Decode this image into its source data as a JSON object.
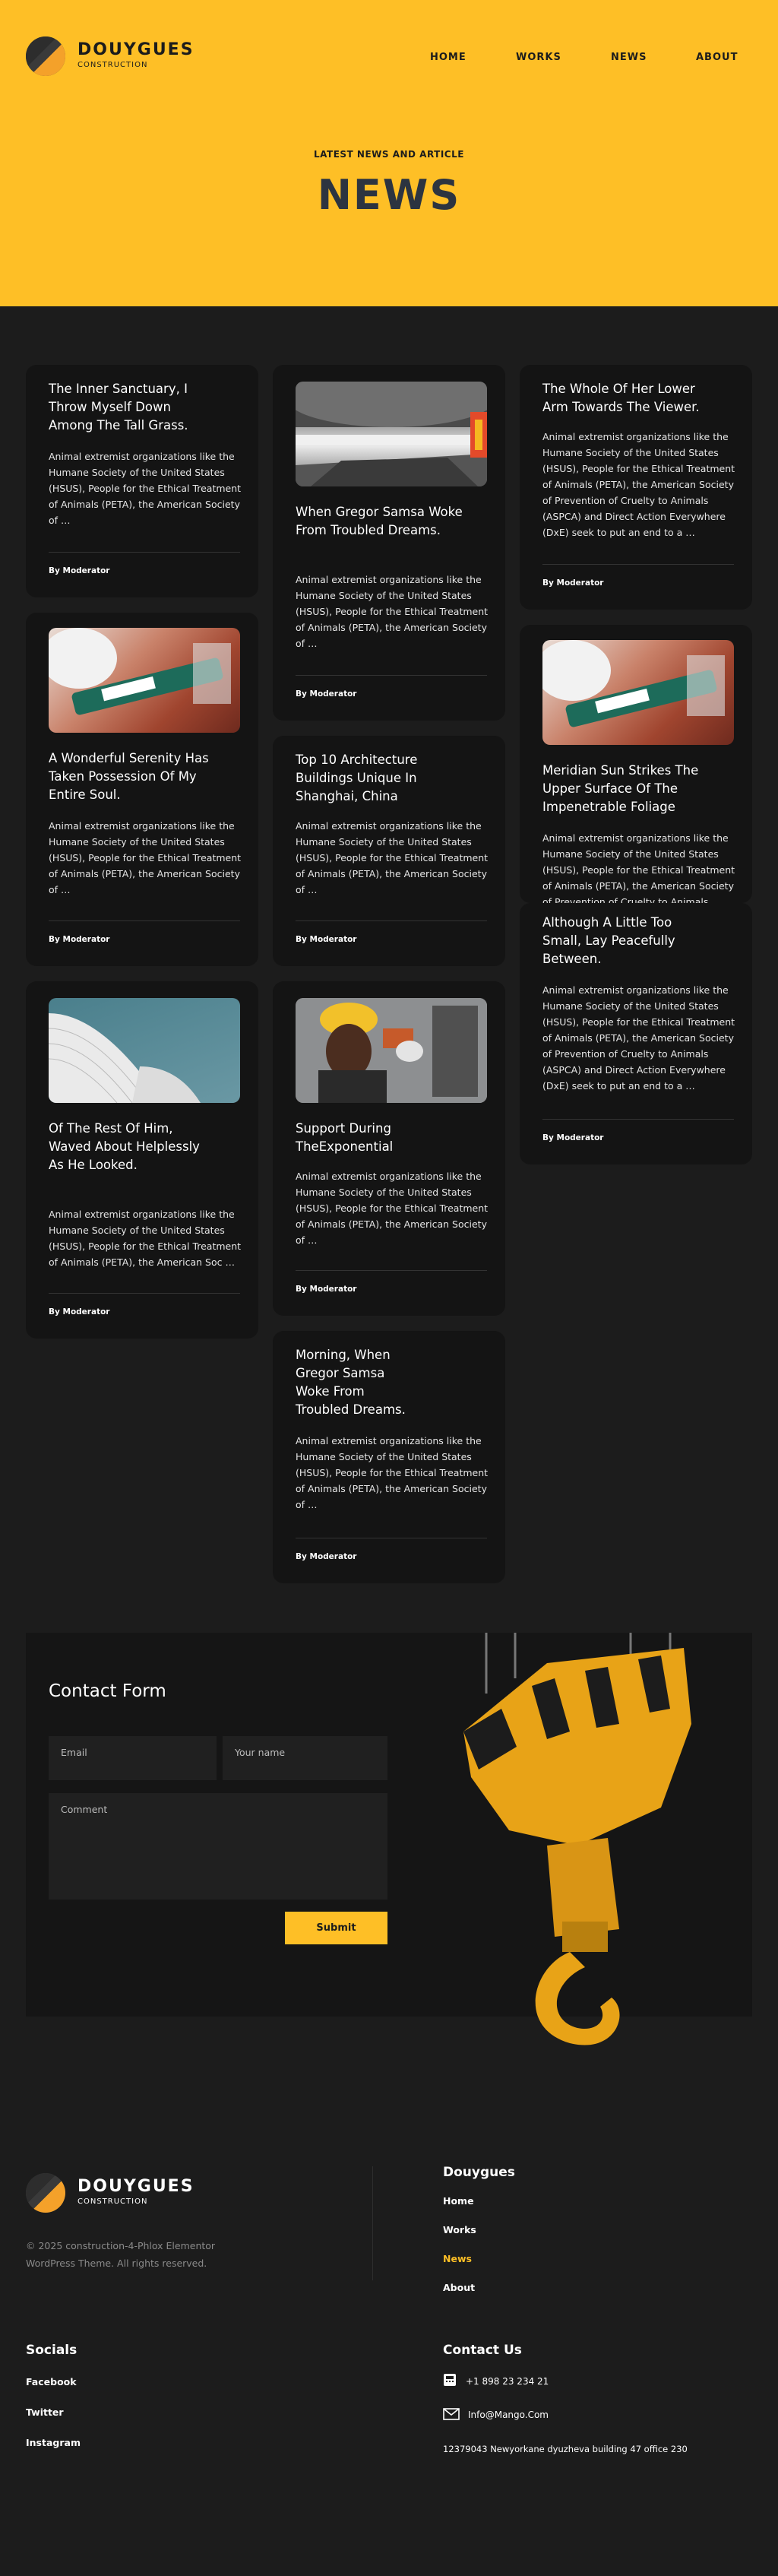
{
  "brand": {
    "name": "DOUYGUES",
    "sub": "CONSTRUCTION"
  },
  "nav": [
    "HOME",
    "WORKS",
    "NEWS",
    "ABOUT"
  ],
  "hero": {
    "eyebrow": "LATEST NEWS AND ARTICLE",
    "title": "NEWS"
  },
  "cards": [
    {
      "title": "The Inner Sanctuary, I Throw Myself Down Among The Tall Grass.",
      "text": "Animal extremist organizations like the Humane Society of the United States (HSUS), People for the Ethical Treatment of Animals (PETA), the American Society of …",
      "author": "By Moderator"
    },
    {
      "title": "When Gregor Samsa Woke From Troubled Dreams.",
      "text": "Animal extremist organizations like the Humane Society of the United States (HSUS), People for the Ethical Treatment of Animals (PETA), the American Society of …",
      "author": "By Moderator",
      "image": "subway-platform"
    },
    {
      "title": "The Whole Of Her Lower Arm Towards The Viewer.",
      "text": "Animal extremist organizations like the Humane Society of the United States (HSUS), People for the Ethical Treatment of Animals (PETA), the American Society of Prevention of Cruelty to Animals (ASPCA) and Direct Action Everywhere (DxE) seek to put an end to a …",
      "author": "By Moderator"
    },
    {
      "title": "A Wonderful Serenity Has Taken Possession Of My Entire Soul.",
      "text": "Animal extremist organizations like the Humane Society of the United States (HSUS), People for the Ethical Treatment of Animals (PETA), the American Society of …",
      "author": "By Moderator",
      "image": "caulk-gun"
    },
    {
      "title": "Top 10 Architecture Buildings Unique In Shanghai, China",
      "text": "Animal extremist organizations like the Humane Society of the United States (HSUS), People for the Ethical Treatment of Animals (PETA), the American Society of …",
      "author": "By Moderator"
    },
    {
      "title": "Meridian Sun Strikes The Upper Surface Of The Impenetrable Foliage",
      "text": "Animal extremist organizations like the Humane Society of the United States (HSUS), People for the Ethical Treatment of Animals (PETA), the American Society of Prevention of Cruelty to Animals (ASPCA)",
      "author": "By Moderator",
      "image": "caulk-gun"
    },
    {
      "title": "Although A Little Too Small, Lay Peacefully Between.",
      "text": "Animal extremist organizations like the Humane Society of the United States (HSUS), People for the Ethical Treatment of Animals (PETA), the American Society of Prevention of Cruelty to Animals (ASPCA) and Direct Action Everywhere (DxE) seek to put an end to a …",
      "author": "By Moderator"
    },
    {
      "title": "Of The Rest Of Him, Waved About Helplessly As He Looked.",
      "text": "Animal extremist organizations like the Humane Society of the United States (HSUS), People for the Ethical Treatment of Animals (PETA), the American Soc …",
      "author": "By Moderator",
      "image": "curved-roof"
    },
    {
      "title": "Support During TheExponential",
      "text": "Animal extremist organizations like the Humane Society of the United States (HSUS), People for the Ethical Treatment of Animals (PETA), the American Society of …",
      "author": "By Moderator",
      "image": "worker-hardhat"
    },
    {
      "title": "Morning, When Gregor Samsa Woke From Troubled Dreams.",
      "text": "Animal extremist organizations like the Humane Society of the United States (HSUS), People for the Ethical Treatment of Animals (PETA), the American Society of …",
      "author": "By Moderator"
    }
  ],
  "contact": {
    "title": "Contact Form",
    "email_placeholder": "Email",
    "name_placeholder": "Your name",
    "comment_placeholder": "Comment",
    "submit": "Submit"
  },
  "footer": {
    "copyright": "© 2025 construction-4-Phlox Elementor WordPress Theme. All rights reserved.",
    "links_title": "Douygues",
    "links": [
      "Home",
      "Works",
      "News",
      "About"
    ],
    "socials_title": "Socials",
    "socials": [
      "Facebook",
      "Twitter",
      "Instagram"
    ],
    "contact_title": "Contact Us",
    "phone": "+1 898 23 234 21",
    "email": "Info@Mango.Com",
    "address": "12379043 Newyorkane dyuzheva building 47 office 230"
  },
  "colors": {
    "accent": "#febf26",
    "dark": "#1c1c1c",
    "card": "#141414",
    "active_link": "#febf26"
  }
}
